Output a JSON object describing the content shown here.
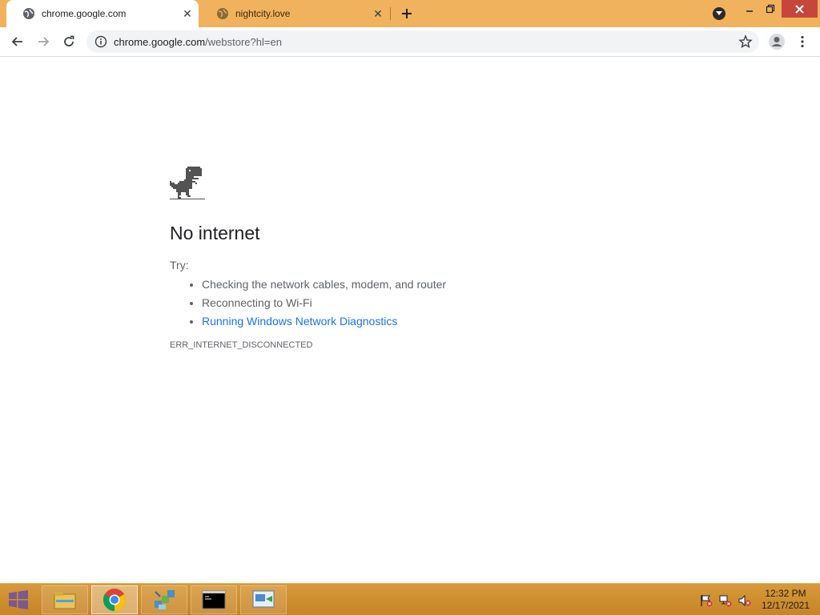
{
  "browser": {
    "tabs": [
      {
        "title": "chrome.google.com",
        "active": true
      },
      {
        "title": "nightcity.love",
        "active": false
      }
    ],
    "address_bar": {
      "host": "chrome.google.com",
      "path": "/webstore?hl=en"
    }
  },
  "page": {
    "heading": "No internet",
    "try_label": "Try:",
    "suggestions": [
      "Checking the network cables, modem, and router",
      "Reconnecting to Wi-Fi",
      "Running Windows Network Diagnostics"
    ],
    "error_code": "ERR_INTERNET_DISCONNECTED"
  },
  "taskbar": {
    "apps": [
      "file-explorer",
      "chrome",
      "network-app",
      "command-prompt",
      "control-panel"
    ],
    "clock_time": "12:32 PM",
    "clock_date": "12/17/2021"
  },
  "colors": {
    "tabstrip": "#f0b25c",
    "link": "#1a73e8",
    "close_button": "#c7463b",
    "taskbar": "#c78428"
  }
}
